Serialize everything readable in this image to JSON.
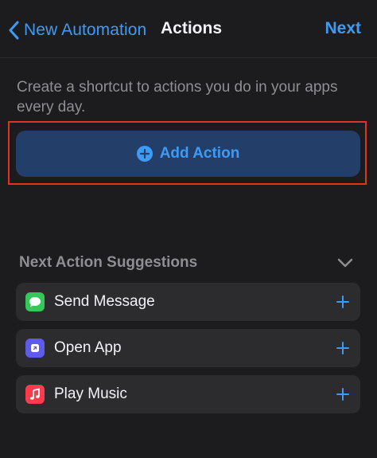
{
  "nav": {
    "back_label": "New Automation",
    "title": "Actions",
    "next_label": "Next"
  },
  "description": "Create a shortcut to actions you do in your apps every day.",
  "add_action": {
    "label": "Add Action"
  },
  "suggestions": {
    "title": "Next Action Suggestions",
    "items": [
      {
        "label": "Send Message",
        "icon": "messages-icon",
        "color": "#34c759"
      },
      {
        "label": "Open App",
        "icon": "open-app-icon",
        "color": "#5e5ce6"
      },
      {
        "label": "Play Music",
        "icon": "music-icon",
        "color": "#fa3c4c"
      }
    ]
  },
  "colors": {
    "accent": "#3d9bf6",
    "background": "#1c1c1e",
    "card": "#2c2c2e",
    "highlight": "#e0341f"
  }
}
